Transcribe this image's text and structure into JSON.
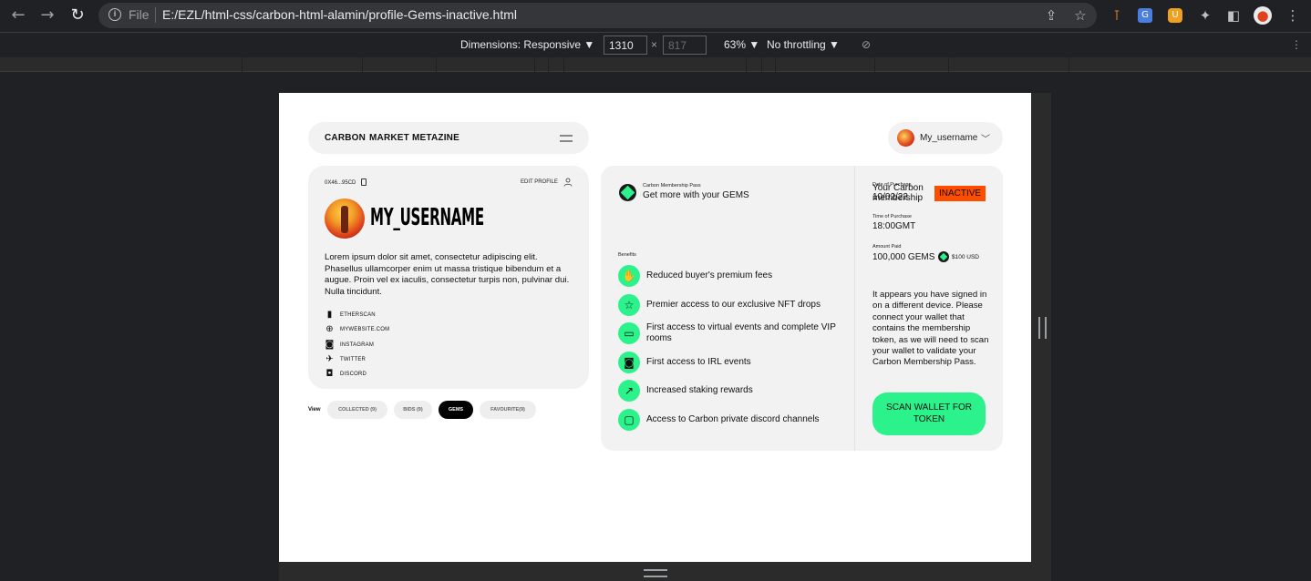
{
  "browser": {
    "file_label": "File",
    "url": "E:/EZL/html-css/carbon-html-alamin/profile-Gems-inactive.html"
  },
  "devtools": {
    "dimensions_label": "Dimensions: Responsive",
    "width": "1310",
    "height": "817",
    "zoom": "63%",
    "throttling": "No throttling"
  },
  "nav": {
    "links": [
      "CARBON",
      "MARKET",
      "METAZINE"
    ],
    "username": "My_username"
  },
  "profile": {
    "address": "0X46...95CD",
    "edit_label": "EDIT PROFILE",
    "username": "MY_USERNAME",
    "bio": "Lorem ipsum dolor sit amet, consectetur adipiscing elit. Phasellus ullamcorper enim ut massa tristique bibendum et a augue. Proin vel ex iaculis, consectetur turpis non, pulvinar dui. Nulla tincidunt.",
    "socials": [
      {
        "icon": "chart-bars-icon",
        "label": "ETHERSCAN"
      },
      {
        "icon": "globe-icon",
        "label": "MYWEBSITE.COM"
      },
      {
        "icon": "instagram-icon",
        "label": "INSTAGRAM"
      },
      {
        "icon": "twitter-icon",
        "label": "TWITTER"
      },
      {
        "icon": "discord-icon",
        "label": "DISCORD"
      }
    ]
  },
  "tabs": {
    "view_label": "View",
    "items": [
      "COLLECTED (9)",
      "BIDS (9)",
      "GEMS",
      "FAVOURITE(9)"
    ],
    "active": "GEMS"
  },
  "gems": {
    "pass_small": "Carbon Membership Pass",
    "pass_main": "Get more with your GEMS",
    "benefits_label": "Benefits",
    "benefits": [
      {
        "icon": "hand-icon",
        "label": "Reduced buyer's premium fees"
      },
      {
        "icon": "star-icon",
        "label": "Premier access to our exclusive NFT drops"
      },
      {
        "icon": "ticket-icon",
        "label": "First access to virtual events and complete VIP rooms"
      },
      {
        "icon": "portrait-icon",
        "label": "First access to IRL events"
      },
      {
        "icon": "trend-icon",
        "label": "Increased staking rewards"
      },
      {
        "icon": "chat-icon",
        "label": "Access to Carbon private discord channels"
      }
    ],
    "membership_text": "Your Carbon membership",
    "date_of_purchase_label": "Date of Purchase",
    "date_of_purchase": "10/02/22",
    "status": "INACTIVE",
    "time_label": "Time of Purchase",
    "time": "18:00GMT",
    "amount_label": "Amount Paid",
    "amount": "100,000 GEMS",
    "amount_usd": "$100 USD",
    "notice": "It appears you have signed in on a different device. Please connect your wallet that contains the membership token, as we will need to scan your wallet to validate your Carbon Membership Pass.",
    "scan_button": "SCAN WALLET FOR TOKEN",
    "accent_color": "#2cf28c",
    "inactive_color": "#ff4d00"
  }
}
